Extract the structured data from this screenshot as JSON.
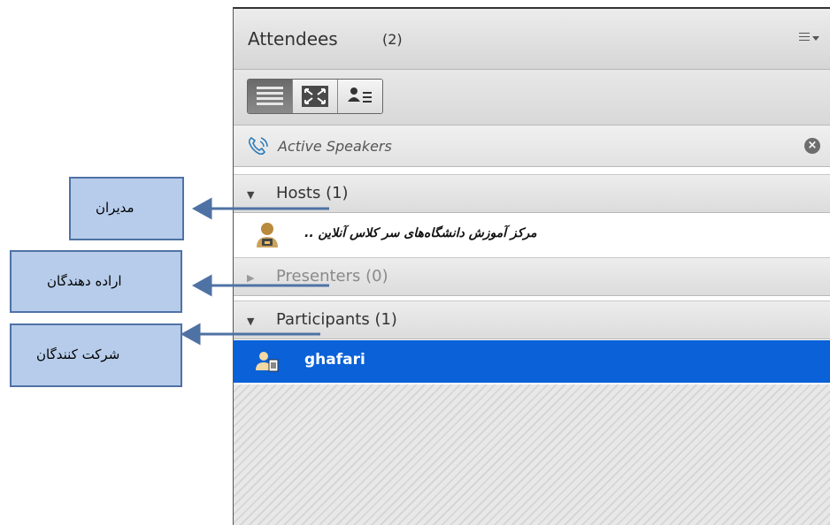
{
  "pod": {
    "title": "Attendees",
    "count": "(2)",
    "menu_icon": "hamburger-menu-icon"
  },
  "toolbar": {
    "views": [
      {
        "icon": "list-view-icon",
        "active": true
      },
      {
        "icon": "fullscreen-icon",
        "active": false
      },
      {
        "icon": "attendee-status-icon",
        "active": false
      }
    ]
  },
  "active_speakers": {
    "label": "Active Speakers",
    "icon": "phone-icon",
    "close_icon": "close-circle-icon"
  },
  "sections": {
    "hosts": {
      "label": "Hosts (1)",
      "expanded": true
    },
    "presenters": {
      "label": "Presenters (0)",
      "expanded": false
    },
    "participants": {
      "label": "Participants (1)",
      "expanded": true
    }
  },
  "host_row": {
    "name": "ﻣﺮﮐﺰ آﻣﻮزش داﻧﺸﮕﺎه‌ﻫﺎی ﺳﺮ ﮐﻼس آﻧﻼﯾﻦ ..",
    "icon": "host-user-icon"
  },
  "participant_row": {
    "name": "ghafari",
    "icon": "participant-user-icon",
    "selected": true
  },
  "callouts": {
    "hosts": "مدیران",
    "presenters": "اراده دهندگان",
    "participants": "شرکت کنندگان"
  },
  "colors": {
    "selection": "#0a61d8",
    "callout_fill": "#b6ccea",
    "callout_border": "#4f72a5",
    "arrow": "#4f72a5"
  }
}
